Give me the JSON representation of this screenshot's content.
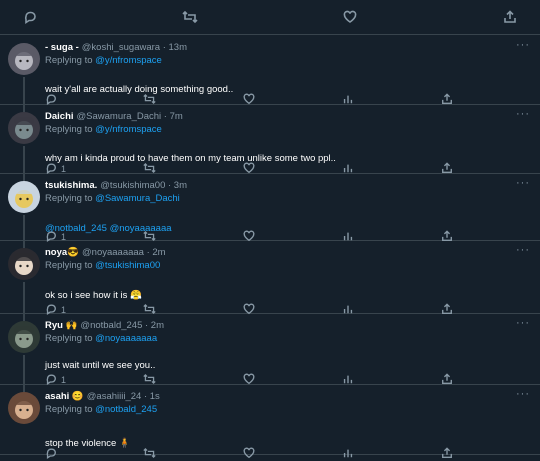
{
  "top_actions": [
    "reply-icon",
    "retweet-icon",
    "like-icon",
    "share-icon"
  ],
  "tweets": [
    {
      "name": "- suga -",
      "handle": "@koshi_sugawara · 13m",
      "replying_label": "Replying to",
      "replying_to": "@y/nfromspace",
      "text": "wait y'all are actually doing something good..",
      "text_mention": "",
      "reply_count": "",
      "avatar_colors": [
        "#b8b8c0",
        "#5a5a66"
      ]
    },
    {
      "name": "Daichi",
      "handle": "@Sawamura_Dachi · 7m",
      "replying_label": "Replying to",
      "replying_to": "@y/nfromspace",
      "text": "why am i kinda proud to have them on my team unlike some two ppl..",
      "text_mention": "",
      "reply_count": "1",
      "avatar_colors": [
        "#7a8a8e",
        "#3a3a44"
      ]
    },
    {
      "name": "tsukishima.",
      "handle": "@tsukishima00 · 3m",
      "replying_label": "Replying to",
      "replying_to": "@Sawamura_Dachi",
      "text": "",
      "text_mention": "@notbald_245 @noyaaaaaaa",
      "reply_count": "1",
      "avatar_colors": [
        "#e6c860",
        "#c8d4e0"
      ]
    },
    {
      "name": "noya😎",
      "handle": "@noyaaaaaaa · 2m",
      "replying_label": "Replying to",
      "replying_to": "@tsukishima00",
      "text": "ok so i see how it is 😤",
      "text_mention": "",
      "reply_count": "1",
      "avatar_colors": [
        "#e8d8c8",
        "#2a2a30"
      ]
    },
    {
      "name": "Ryu 🙌",
      "handle": "@notbald_245 · 2m",
      "replying_label": "Replying to",
      "replying_to": "@noyaaaaaaa",
      "text": "just wait until we see you..",
      "text_mention": "",
      "reply_count": "1",
      "avatar_colors": [
        "#8a9a8c",
        "#2e3a36"
      ]
    },
    {
      "name": "asahi 😊",
      "handle": "@asahiiii_24 · 1s",
      "replying_label": "Replying to",
      "replying_to": "@notbald_245",
      "text": "stop the violence 🧍",
      "text_mention": "",
      "reply_count": "",
      "avatar_colors": [
        "#d8b090",
        "#6a4a3a"
      ]
    }
  ],
  "more_label": "···"
}
